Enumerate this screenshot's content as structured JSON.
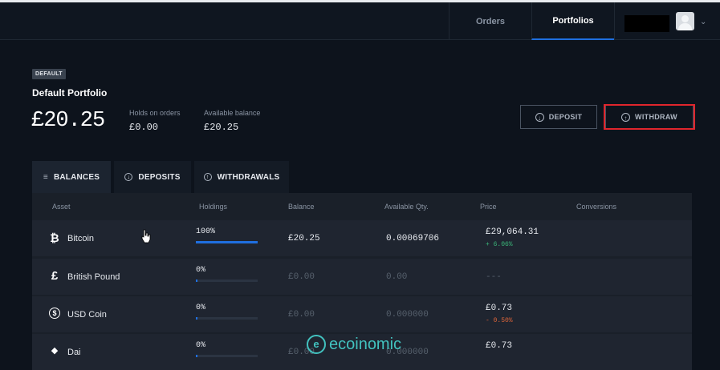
{
  "nav": {
    "orders": "Orders",
    "portfolios": "Portfolios"
  },
  "portfolio": {
    "badge": "DEFAULT",
    "name": "Default Portfolio",
    "total": "£20.25",
    "holds_label": "Holds on orders",
    "holds_value": "£0.00",
    "available_label": "Available balance",
    "available_value": "£20.25"
  },
  "actions": {
    "deposit": "DEPOSIT",
    "withdraw": "WITHDRAW"
  },
  "tabs": [
    {
      "label": "BALANCES",
      "icon": "list-icon"
    },
    {
      "label": "DEPOSITS",
      "icon": "arrow-down-circle-icon"
    },
    {
      "label": "WITHDRAWALS",
      "icon": "arrow-up-circle-icon"
    }
  ],
  "table": {
    "headers": [
      "Asset",
      "Holdings",
      "Balance",
      "Available Qty.",
      "Price",
      "Conversions"
    ],
    "rows": [
      {
        "icon": "bitcoin-icon",
        "glyph": "₿",
        "asset": "Bitcoin",
        "holdings": "100%",
        "holdings_fraction": 1.0,
        "balance": "£20.25",
        "available": "0.00069706",
        "price": "£29,064.31",
        "change": "+ 6.06%"
      },
      {
        "icon": "pound-icon",
        "glyph": "£",
        "asset": "British Pound",
        "holdings": "0%",
        "holdings_fraction": 0.0,
        "balance": "£0.00",
        "available": "0.00",
        "price": "---",
        "change": ""
      },
      {
        "icon": "usd-coin-icon",
        "glyph": "$",
        "asset": "USD Coin",
        "holdings": "0%",
        "holdings_fraction": 0.0,
        "balance": "£0.00",
        "available": "0.000000",
        "price": "£0.73",
        "change": "- 0.50%"
      },
      {
        "icon": "dai-icon",
        "glyph": "◆",
        "asset": "Dai",
        "holdings": "0%",
        "holdings_fraction": 0.0,
        "balance": "£0.00",
        "available": "0.000000",
        "price": "£0.73",
        "change": ""
      }
    ]
  },
  "watermark": "ecoinomic",
  "colors": {
    "accent": "#1f6fe0",
    "highlight": "#e0252c",
    "positive": "#3bb97a",
    "negative": "#e0663a"
  }
}
